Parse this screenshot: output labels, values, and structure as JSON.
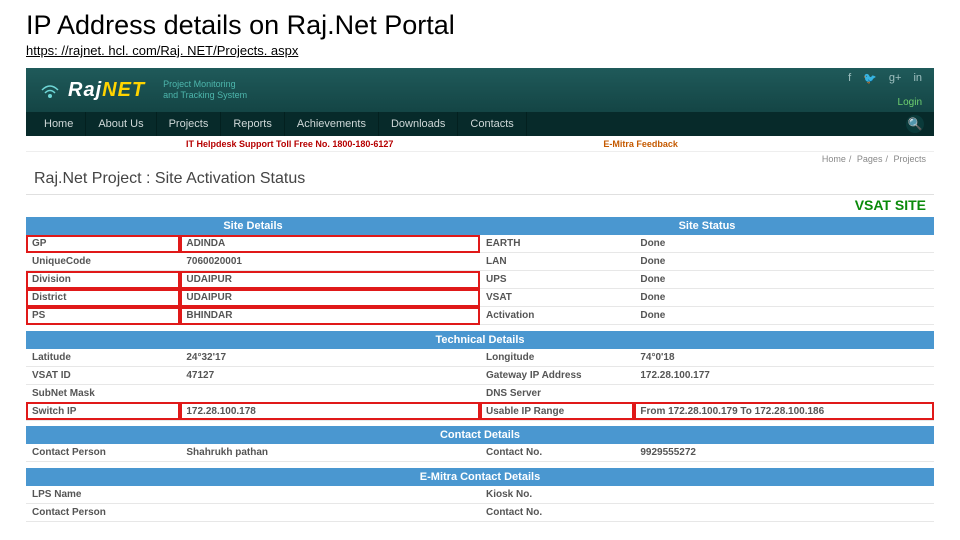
{
  "slide": {
    "title": "IP Address details on Raj.Net Portal",
    "url": "https: //rajnet. hcl. com/Raj. NET/Projects. aspx"
  },
  "branding": {
    "logo_prefix": "Raj",
    "logo_suffix": "NET",
    "tagline_line1": "Project Monitoring",
    "tagline_line2": "and Tracking System",
    "login": "Login"
  },
  "nav": {
    "items": [
      "Home",
      "About Us",
      "Projects",
      "Reports",
      "Achievements",
      "Downloads",
      "Contacts"
    ]
  },
  "subbar": {
    "helpdesk": "IT Helpdesk Support Toll Free No. 1800-180-6127",
    "feedback": "E-Mitra Feedback"
  },
  "breadcrumb": {
    "a": "Home",
    "b": "Pages",
    "c": "Projects"
  },
  "page": {
    "title": "Raj.Net Project : Site Activation Status",
    "vsat": "VSAT SITE"
  },
  "sections": {
    "site_details": "Site Details",
    "site_status": "Site Status",
    "technical": "Technical Details",
    "contact": "Contact Details",
    "emitra": "E-Mitra Contact Details"
  },
  "site_details": {
    "gp_label": "GP",
    "gp": "ADINDA",
    "code_label": "UniqueCode",
    "code": "7060020001",
    "division_label": "Division",
    "division": "UDAIPUR",
    "district_label": "District",
    "district": "UDAIPUR",
    "ps_label": "PS",
    "ps": "BHINDAR"
  },
  "site_status": {
    "earth_label": "EARTH",
    "earth": "Done",
    "lan_label": "LAN",
    "lan": "Done",
    "ups_label": "UPS",
    "ups": "Done",
    "vsat_label": "VSAT",
    "vsat": "Done",
    "activation_label": "Activation",
    "activation": "Done"
  },
  "technical": {
    "lat_label": "Latitude",
    "lat": "24°32'17",
    "lon_label": "Longitude",
    "lon": "74°0'18",
    "vsatid_label": "VSAT ID",
    "vsatid": "47127",
    "gwip_label": "Gateway IP Address",
    "gwip": "172.28.100.177",
    "subnet_label": "SubNet Mask",
    "subnet": "",
    "dns_label": "DNS Server",
    "dns": "",
    "switch_label": "Switch IP",
    "switch": "172.28.100.178",
    "range_label": "Usable IP Range",
    "range": "From 172.28.100.179 To 172.28.100.186"
  },
  "contact": {
    "person_label": "Contact Person",
    "person": "Shahrukh pathan",
    "number_label": "Contact No.",
    "number": "9929555272"
  },
  "emitra": {
    "lps_label": "LPS Name",
    "lps": "",
    "kiosk_label": "Kiosk No.",
    "kiosk": "",
    "cp_label": "Contact Person",
    "cp": "",
    "cn_label": "Contact No.",
    "cn": ""
  }
}
